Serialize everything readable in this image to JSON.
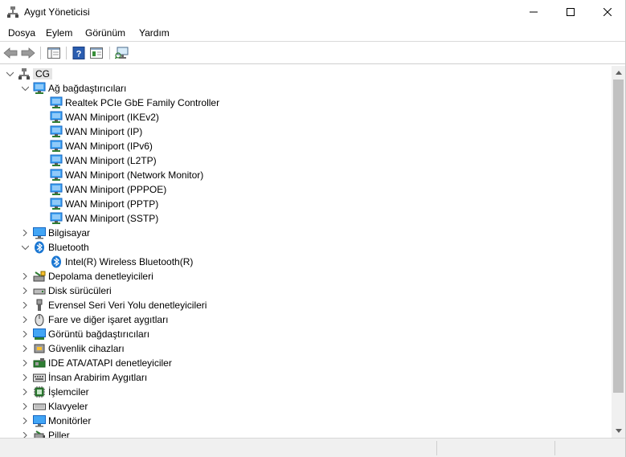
{
  "window": {
    "title": "Aygıt Yöneticisi"
  },
  "menu": [
    "Dosya",
    "Eylem",
    "Görünüm",
    "Yardım"
  ],
  "colors": {
    "accent": "#1e88e5",
    "selection": "#e5e5e5",
    "scroll_thumb": "#c1c1c1"
  },
  "tree": {
    "root": {
      "label": "CG",
      "icon": "computer-icon"
    },
    "items": [
      {
        "label": "Ağ bağdaştırıcıları",
        "level": 1,
        "expanded": true,
        "icon": "network-adapter-icon"
      },
      {
        "label": "Realtek PCIe GbE Family Controller",
        "level": 2,
        "icon": "network-adapter-icon"
      },
      {
        "label": "WAN Miniport (IKEv2)",
        "level": 2,
        "icon": "network-adapter-icon"
      },
      {
        "label": "WAN Miniport (IP)",
        "level": 2,
        "icon": "network-adapter-icon"
      },
      {
        "label": "WAN Miniport (IPv6)",
        "level": 2,
        "icon": "network-adapter-icon"
      },
      {
        "label": "WAN Miniport (L2TP)",
        "level": 2,
        "icon": "network-adapter-icon"
      },
      {
        "label": "WAN Miniport (Network Monitor)",
        "level": 2,
        "icon": "network-adapter-icon"
      },
      {
        "label": "WAN Miniport (PPPOE)",
        "level": 2,
        "icon": "network-adapter-icon"
      },
      {
        "label": "WAN Miniport (PPTP)",
        "level": 2,
        "icon": "network-adapter-icon"
      },
      {
        "label": "WAN Miniport (SSTP)",
        "level": 2,
        "icon": "network-adapter-icon"
      },
      {
        "label": "Bilgisayar",
        "level": 1,
        "expanded": false,
        "icon": "monitor-icon"
      },
      {
        "label": "Bluetooth",
        "level": 1,
        "expanded": true,
        "icon": "bluetooth-icon"
      },
      {
        "label": "Intel(R) Wireless Bluetooth(R)",
        "level": 2,
        "icon": "bluetooth-icon"
      },
      {
        "label": "Depolama denetleyicileri",
        "level": 1,
        "expanded": false,
        "icon": "storage-controller-icon"
      },
      {
        "label": "Disk sürücüleri",
        "level": 1,
        "expanded": false,
        "icon": "disk-drive-icon"
      },
      {
        "label": "Evrensel Seri Veri Yolu denetleyicileri",
        "level": 1,
        "expanded": false,
        "icon": "usb-icon"
      },
      {
        "label": "Fare ve diğer işaret aygıtları",
        "level": 1,
        "expanded": false,
        "icon": "mouse-icon"
      },
      {
        "label": "Görüntü bağdaştırıcıları",
        "level": 1,
        "expanded": false,
        "icon": "display-adapter-icon"
      },
      {
        "label": "Güvenlik cihazları",
        "level": 1,
        "expanded": false,
        "icon": "security-device-icon"
      },
      {
        "label": "IDE ATA/ATAPI denetleyiciler",
        "level": 1,
        "expanded": false,
        "icon": "ide-controller-icon"
      },
      {
        "label": "İnsan Arabirim Aygıtları",
        "level": 1,
        "expanded": false,
        "icon": "hid-icon"
      },
      {
        "label": "İşlemciler",
        "level": 1,
        "expanded": false,
        "icon": "processor-icon"
      },
      {
        "label": "Klavyeler",
        "level": 1,
        "expanded": false,
        "icon": "keyboard-icon"
      },
      {
        "label": "Monitörler",
        "level": 1,
        "expanded": false,
        "icon": "monitor-icon"
      },
      {
        "label": "Piller",
        "level": 1,
        "expanded": false,
        "icon": "battery-icon"
      }
    ]
  }
}
